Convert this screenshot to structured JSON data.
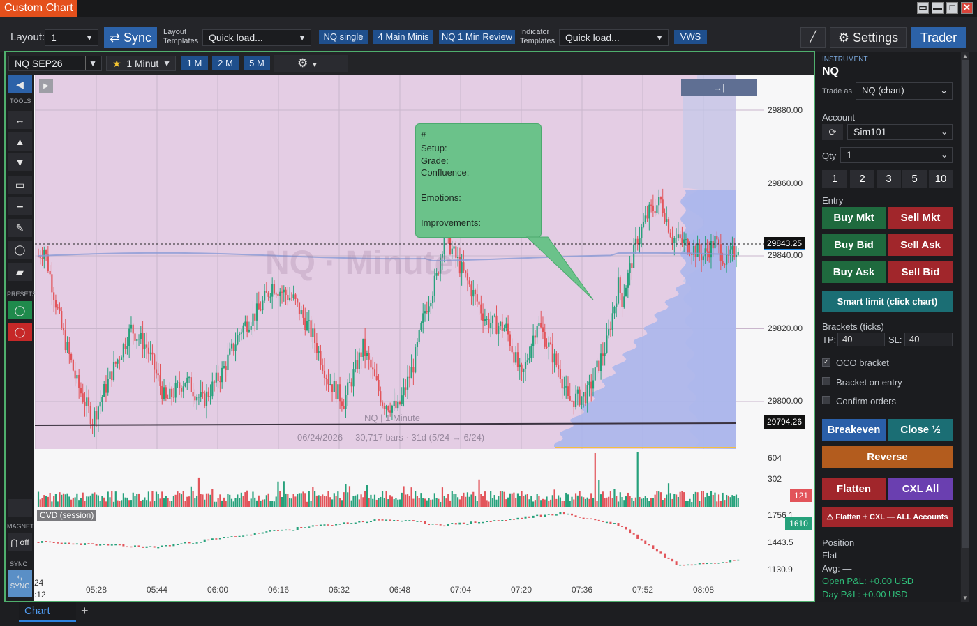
{
  "window": {
    "title": "Custom Chart"
  },
  "toolbar": {
    "layout_label": "Layout:",
    "layout_value": "1",
    "sync_label": "⇄ Sync",
    "layout_templates_label_1": "Layout",
    "layout_templates_label_2": "Templates",
    "quick_load_1": "Quick load...",
    "templates": [
      "NQ single",
      "4 Main Minis",
      "NQ 1 Min Review"
    ],
    "indicator_templates_label_1": "Indicator",
    "indicator_templates_label_2": "Templates",
    "quick_load_2": "Quick load...",
    "vws": "VWS",
    "settings_label": "Settings",
    "trader_label": "Trader"
  },
  "chart_header": {
    "instrument": "NQ SEP26",
    "interval": "1 Minut",
    "intervals": [
      "1 M",
      "2 M",
      "5 M"
    ]
  },
  "tools": {
    "tools_label": "TOOLS",
    "presets_label": "PRESETS",
    "magnet_label": "MAGNET",
    "magnet_value": "off",
    "sync_label": "SYNC",
    "sync_btn": "SYNC"
  },
  "chart": {
    "watermark": "NQ · Minute",
    "note_lines": [
      "#",
      "Setup:",
      "Grade:",
      "Confluence:",
      "",
      "Emotions:",
      "",
      "Improvements:"
    ],
    "footer_title": "NQ | 1 Minute",
    "footer_info": "06/24/2026     30,717 bars · 31d (5/24 → 6/24)",
    "current_price": "29843.25",
    "vwap_price": "29794.26",
    "volume_current": "121",
    "cvd_current": "1610",
    "cvd_label": "CVD (session)",
    "date_label_top": "24",
    "date_label_bottom": ":12",
    "jump_label": "→|",
    "colors": {
      "bull": "#26a17b",
      "bear": "#e2545a",
      "profile": "#a8b5ec",
      "note": "#6bc28a"
    }
  },
  "chart_data": [
    {
      "type": "candlestick",
      "title": "NQ | 1 Minute",
      "ylim": [
        29787,
        29890
      ],
      "yticks": [
        29800.0,
        29820.0,
        29840.0,
        29860.0,
        29880.0
      ],
      "xticks": [
        "05:28",
        "05:44",
        "06:00",
        "06:16",
        "06:32",
        "06:48",
        "07:04",
        "07:20",
        "07:36",
        "07:52",
        "08:08"
      ],
      "close_path": [
        [
          0,
          29840
        ],
        [
          3,
          29842
        ],
        [
          12,
          29820
        ],
        [
          20,
          29805
        ],
        [
          28,
          29795
        ],
        [
          38,
          29808
        ],
        [
          48,
          29820
        ],
        [
          56,
          29815
        ],
        [
          66,
          29800
        ],
        [
          76,
          29806
        ],
        [
          85,
          29800
        ],
        [
          95,
          29808
        ],
        [
          105,
          29820
        ],
        [
          114,
          29825
        ],
        [
          121,
          29832
        ],
        [
          132,
          29828
        ],
        [
          142,
          29818
        ],
        [
          150,
          29806
        ],
        [
          158,
          29800
        ],
        [
          168,
          29815
        ],
        [
          178,
          29800
        ],
        [
          186,
          29798
        ],
        [
          194,
          29810
        ],
        [
          200,
          29825
        ],
        [
          206,
          29834
        ],
        [
          210,
          29846
        ],
        [
          220,
          29835
        ],
        [
          232,
          29822
        ],
        [
          242,
          29820
        ],
        [
          250,
          29806
        ],
        [
          258,
          29822
        ],
        [
          270,
          29808
        ],
        [
          274,
          29800
        ],
        [
          284,
          29802
        ],
        [
          294,
          29816
        ],
        [
          300,
          29832
        ],
        [
          302,
          29828
        ],
        [
          310,
          29845
        ],
        [
          316,
          29852
        ],
        [
          322,
          29855
        ],
        [
          328,
          29845
        ],
        [
          336,
          29843
        ],
        [
          344,
          29840
        ],
        [
          350,
          29844
        ],
        [
          356,
          29838
        ],
        [
          362,
          29843
        ]
      ],
      "current_price": 29843.25,
      "level_line": 29794.26
    },
    {
      "type": "bar",
      "title": "Volume",
      "yticks": [
        302,
        604
      ],
      "current": 121
    },
    {
      "type": "line",
      "title": "CVD (session)",
      "yticks": [
        1130.9,
        1443.5,
        1756.1
      ],
      "ylim": [
        1050,
        1800
      ],
      "x": [
        0,
        30,
        60,
        90,
        120,
        150,
        180,
        210,
        240,
        270,
        300,
        330,
        362
      ],
      "values": [
        1440,
        1410,
        1380,
        1470,
        1560,
        1640,
        1700,
        1640,
        1690,
        1770,
        1640,
        1180,
        1230
      ],
      "values_2": [
        1400,
        1250,
        1650,
        1700,
        1730,
        1730,
        1700,
        1610
      ],
      "x_2": [
        300,
        305,
        315,
        320,
        330,
        345,
        355,
        362
      ],
      "current": 1610
    }
  ],
  "right_panel": {
    "instrument_label": "INSTRUMENT",
    "instrument": "NQ",
    "trade_as_label": "Trade as",
    "trade_as_value": "NQ  (chart)",
    "account_label": "Account",
    "account_value": "Sim101",
    "qty_label": "Qty",
    "qty_value": "1",
    "qty_presets": [
      "1",
      "2",
      "3",
      "5",
      "10"
    ],
    "entry_label": "Entry",
    "entry_buttons": [
      [
        "Buy Mkt",
        "Sell Mkt"
      ],
      [
        "Buy Bid",
        "Sell Ask"
      ],
      [
        "Buy Ask",
        "Sell Bid"
      ]
    ],
    "smart_limit": "Smart limit (click chart)",
    "brackets_label": "Brackets (ticks)",
    "tp_label": "TP:",
    "tp_value": "40",
    "sl_label": "SL:",
    "sl_value": "40",
    "oco_label": "OCO bracket",
    "bracket_entry_label": "Bracket on entry",
    "confirm_label": "Confirm orders",
    "breakeven": "Breakeven",
    "close_half": "Close ½",
    "reverse": "Reverse",
    "flatten": "Flatten",
    "cxl_all": "CXL All",
    "flatten_all": "⚠ Flatten + CXL — ALL Accounts",
    "position_label": "Position",
    "position_value": "Flat",
    "avg_label": "Avg: —",
    "open_pnl": "Open P&L: +0.00 USD",
    "day_pnl": "Day P&L: +0.00 USD"
  },
  "tabs": {
    "active": "Chart",
    "add": "+"
  }
}
